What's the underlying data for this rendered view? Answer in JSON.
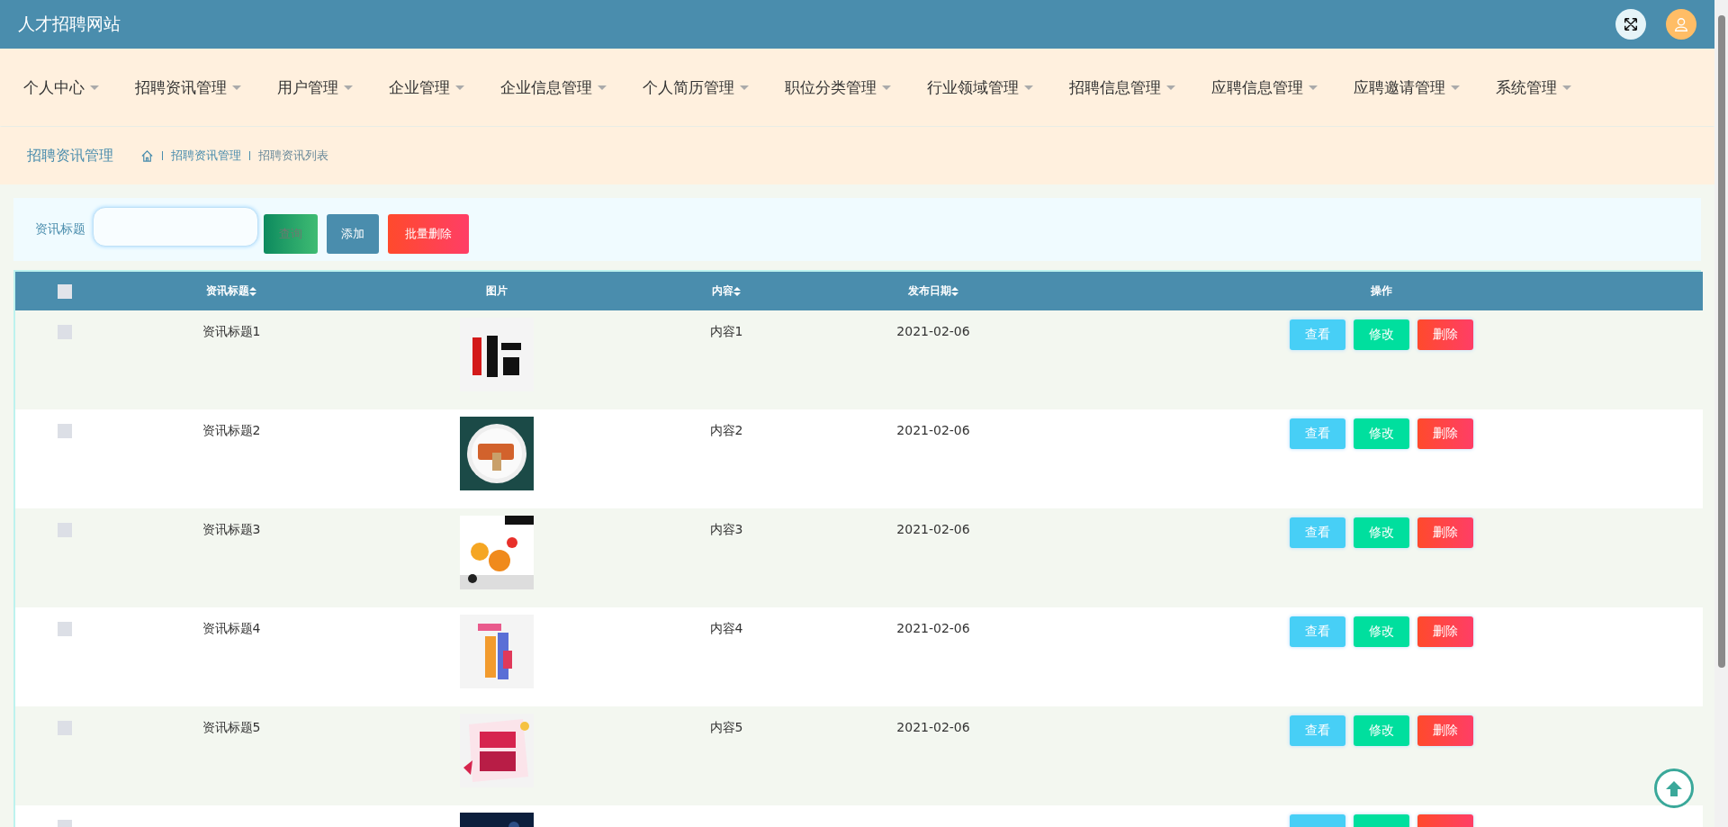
{
  "header": {
    "title": "人才招聘网站"
  },
  "nav": [
    {
      "label": "个人中心"
    },
    {
      "label": "招聘资讯管理"
    },
    {
      "label": "用户管理"
    },
    {
      "label": "企业管理"
    },
    {
      "label": "企业信息管理"
    },
    {
      "label": "个人简历管理"
    },
    {
      "label": "职位分类管理"
    },
    {
      "label": "行业领域管理"
    },
    {
      "label": "招聘信息管理"
    },
    {
      "label": "应聘信息管理"
    },
    {
      "label": "应聘邀请管理"
    },
    {
      "label": "系统管理"
    }
  ],
  "breadcrumb": {
    "title": "招聘资讯管理",
    "path": [
      "招聘资讯管理",
      "招聘资讯列表"
    ]
  },
  "search": {
    "label": "资讯标题",
    "buttons": [
      {
        "label": "查询",
        "kind": "search"
      },
      {
        "label": "添加",
        "kind": "add"
      },
      {
        "label": "批量删除",
        "kind": "delete"
      }
    ]
  },
  "table": {
    "select_all": {
      "checked": false
    },
    "columns": [
      {
        "label": "资讯标题",
        "sortable": true
      },
      {
        "label": "图片",
        "sortable": false
      },
      {
        "label": "内容",
        "sortable": true
      },
      {
        "label": "发布日期",
        "sortable": true
      },
      {
        "label": "操作",
        "sortable": false
      }
    ],
    "rows": [
      {
        "checked": false,
        "title": "资讯标题1",
        "content": "内容1",
        "date": "2021-02-06",
        "actions": [
          {
            "label": "查看",
            "kind": "view"
          },
          {
            "label": "修改",
            "kind": "edit"
          },
          {
            "label": "删除",
            "kind": "delete"
          }
        ]
      },
      {
        "checked": false,
        "title": "资讯标题2",
        "content": "内容2",
        "date": "2021-02-06",
        "actions": [
          {
            "label": "查看",
            "kind": "view"
          },
          {
            "label": "修改",
            "kind": "edit"
          },
          {
            "label": "删除",
            "kind": "delete"
          }
        ]
      },
      {
        "checked": false,
        "title": "资讯标题3",
        "content": "内容3",
        "date": "2021-02-06",
        "actions": [
          {
            "label": "查看",
            "kind": "view"
          },
          {
            "label": "修改",
            "kind": "edit"
          },
          {
            "label": "删除",
            "kind": "delete"
          }
        ]
      },
      {
        "checked": false,
        "title": "资讯标题4",
        "content": "内容4",
        "date": "2021-02-06",
        "actions": [
          {
            "label": "查看",
            "kind": "view"
          },
          {
            "label": "修改",
            "kind": "edit"
          },
          {
            "label": "删除",
            "kind": "delete"
          }
        ]
      },
      {
        "checked": false,
        "title": "资讯标题5",
        "content": "内容5",
        "date": "2021-02-06",
        "actions": [
          {
            "label": "查看",
            "kind": "view"
          },
          {
            "label": "修改",
            "kind": "edit"
          },
          {
            "label": "删除",
            "kind": "delete"
          }
        ]
      },
      {
        "checked": false,
        "actions": [
          {
            "kind": "view"
          },
          {
            "kind": "edit"
          },
          {
            "kind": "delete"
          }
        ]
      }
    ]
  }
}
